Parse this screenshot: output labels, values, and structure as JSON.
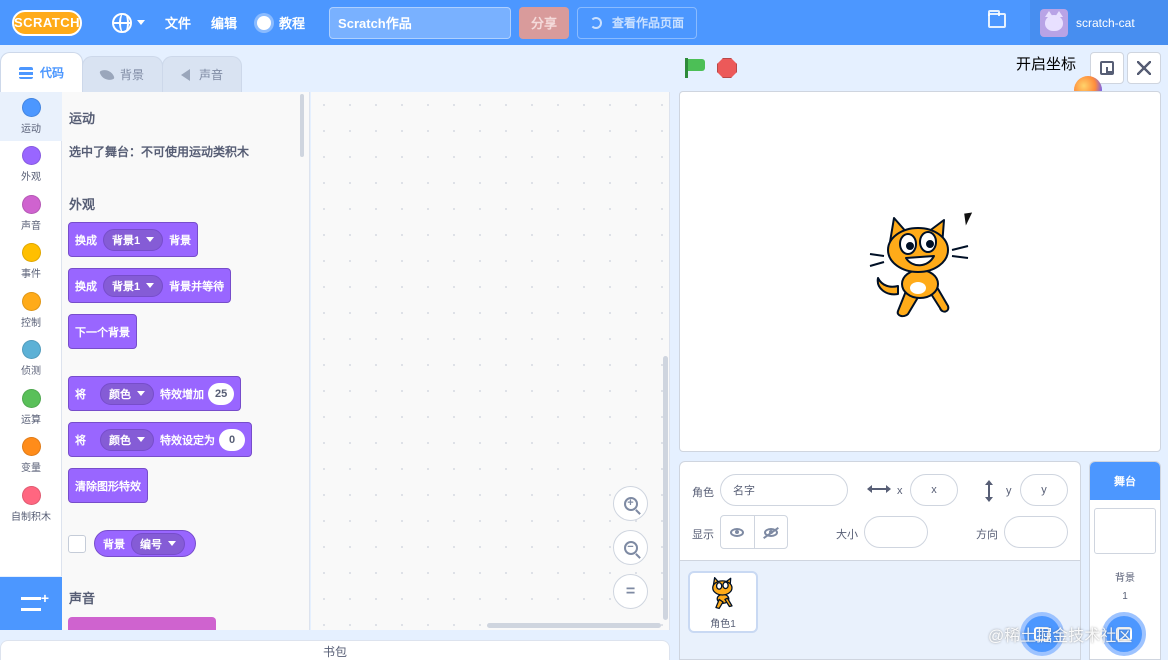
{
  "menubar": {
    "logo": "SCRATCH",
    "file": "文件",
    "edit": "编辑",
    "tutorials": "教程",
    "project_title": "Scratch作品",
    "share": "分享",
    "see_project_page": "查看作品页面",
    "username": "scratch-cat",
    "colors": {
      "bar": "#4c97ff"
    }
  },
  "tabs": [
    {
      "label": "代码",
      "icon": "code-icon"
    },
    {
      "label": "背景",
      "icon": "brush-icon"
    },
    {
      "label": "声音",
      "icon": "speaker-icon"
    }
  ],
  "categories": [
    {
      "label": "运动",
      "color": "#4c97ff"
    },
    {
      "label": "外观",
      "color": "#9966ff"
    },
    {
      "label": "声音",
      "color": "#cf63cf"
    },
    {
      "label": "事件",
      "color": "#ffbf00"
    },
    {
      "label": "控制",
      "color": "#ffab19"
    },
    {
      "label": "侦测",
      "color": "#5cb1d6"
    },
    {
      "label": "运算",
      "color": "#59c059"
    },
    {
      "label": "变量",
      "color": "#ff8c1a"
    },
    {
      "label": "自制积木",
      "color": "#ff6680"
    }
  ],
  "palette": {
    "motion_heading": "运动",
    "motion_note": "选中了舞台：不可使用运动类积木",
    "looks_heading": "外观",
    "sound_heading": "声音",
    "blocks": {
      "b1_pre": "换成",
      "b1_dd": "背景1",
      "b1_post": "背景",
      "b2_pre": "换成",
      "b2_dd": "背景1",
      "b2_post": "背景并等待",
      "b3": "下一个背景",
      "b4_pre": "将",
      "b4_dd": "颜色",
      "b4_post": "特效增加",
      "b4_val": "25",
      "b5_pre": "将",
      "b5_dd": "颜色",
      "b5_post": "特效设定为",
      "b5_val": "0",
      "b6": "清除图形特效",
      "r1_label": "背景",
      "r1_dd": "编号"
    }
  },
  "script_area": {
    "zoom_in": "+",
    "zoom_out": "−",
    "zoom_reset": "="
  },
  "backpack": "书包",
  "stage_header": {
    "coord_toggle": "开启坐标"
  },
  "sprite_info": {
    "sprite_label": "角色",
    "name_placeholder": "名字",
    "x_label": "x",
    "x_placeholder": "x",
    "y_label": "y",
    "y_placeholder": "y",
    "show_label": "显示",
    "size_label": "大小",
    "direction_label": "方向"
  },
  "sprites": [
    {
      "name": "角色1"
    }
  ],
  "stage_pane": {
    "title": "舞台",
    "backdrops_label": "背景",
    "backdrops_count": "1"
  },
  "watermark": "@稀土掘金技术社区"
}
